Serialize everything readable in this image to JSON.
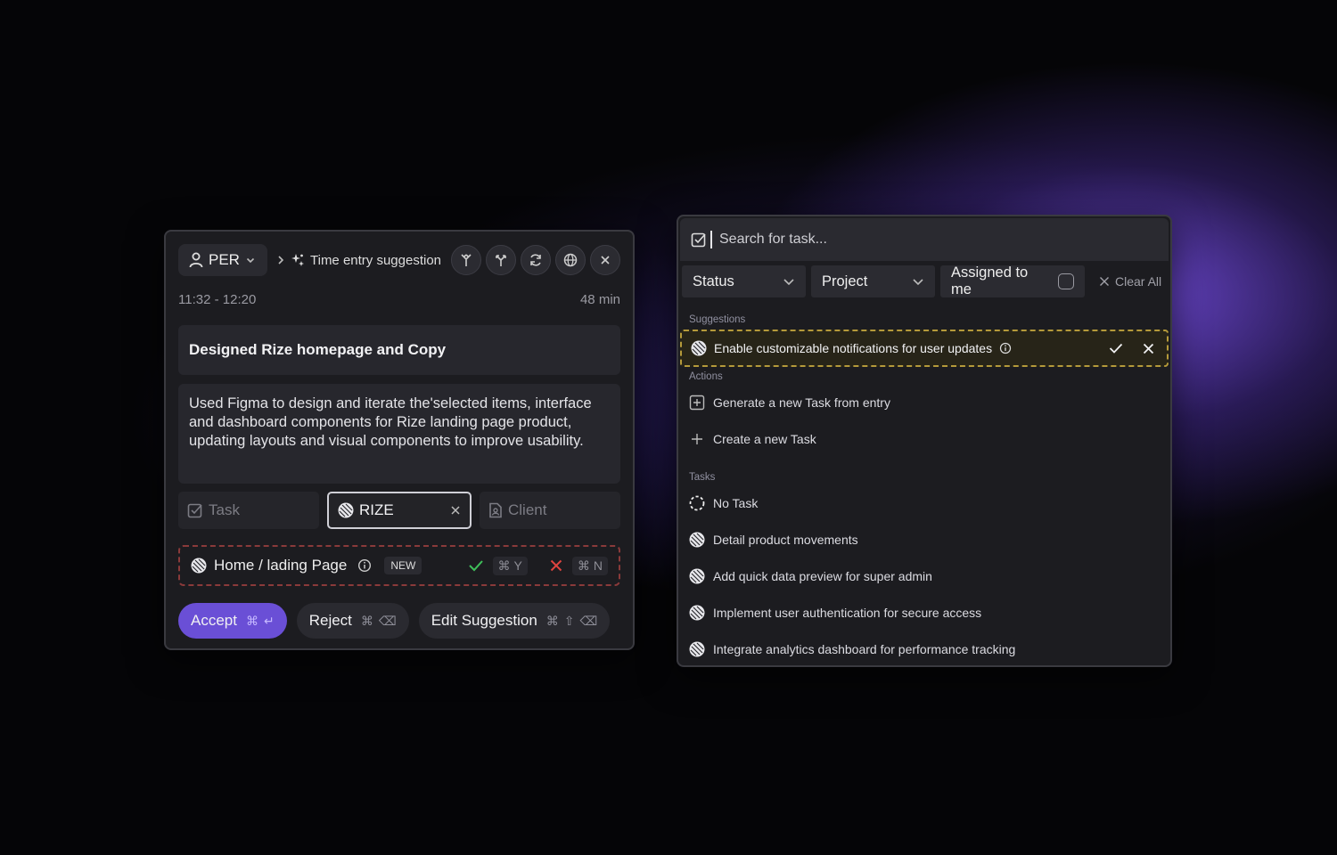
{
  "left_panel": {
    "user_label": "PER",
    "breadcrumb": "Time entry suggestion",
    "time_range": "11:32 - 12:20",
    "duration": "48 min",
    "title": "Designed Rize homepage and Copy",
    "description": "Used Figma to design and iterate the'selected items, interface and dashboard components for Rize landing page product, updating layouts and visual components to improve usability.",
    "chips": {
      "task": "Task",
      "project": "RIZE",
      "client": "Client"
    },
    "suggestion": {
      "label": "Home / lading Page",
      "badge": "NEW",
      "accept_key": "Y",
      "reject_key": "N"
    },
    "buttons": {
      "accept": "Accept",
      "reject": "Reject",
      "edit": "Edit Suggestion"
    }
  },
  "right_panel": {
    "search_placeholder": "Search for task...",
    "filters": {
      "status": "Status",
      "project": "Project",
      "assigned": "Assigned to me",
      "clear": "Clear All"
    },
    "sections": {
      "suggestions": "Suggestions",
      "actions": "Actions",
      "tasks": "Tasks"
    },
    "suggestion_item": "Enable customizable notifications for user updates",
    "actions": [
      "Generate a new Task from entry",
      "Create a new Task"
    ],
    "tasks": [
      "No Task",
      "Detail product movements",
      "Add quick data preview for super admin",
      "Implement user authentication for secure access",
      "Integrate analytics dashboard for performance tracking"
    ]
  },
  "colors": {
    "accent": "#6a4fd6",
    "accept_green": "#3fbf5a",
    "reject_red": "#e0443f",
    "suggestion_border": "#b59a3a"
  }
}
